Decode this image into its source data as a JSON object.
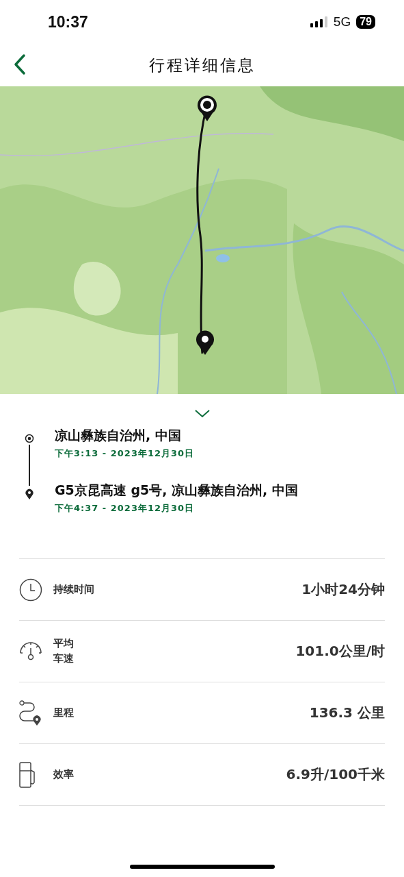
{
  "status_bar": {
    "time": "10:37",
    "network": "5G",
    "battery": "79"
  },
  "header": {
    "title": "行程详细信息"
  },
  "stops": [
    {
      "kind": "start",
      "place": "凉山彝族自治州, 中国",
      "time": "下午3:13 - 2023年12月30日"
    },
    {
      "kind": "end",
      "place": "G5京昆高速 g5号, 凉山彝族自治州, 中国",
      "time": "下午4:37 - 2023年12月30日"
    }
  ],
  "stats": [
    {
      "kind": "duration",
      "label": "持续时间",
      "value": "1小时24分钟"
    },
    {
      "kind": "speed",
      "label": "平均车速",
      "value": "101.0公里/时"
    },
    {
      "kind": "distance",
      "label": "里程",
      "value": "136.3 公里"
    },
    {
      "kind": "fuel",
      "label": "效率",
      "value": "6.9升/100千米"
    }
  ]
}
